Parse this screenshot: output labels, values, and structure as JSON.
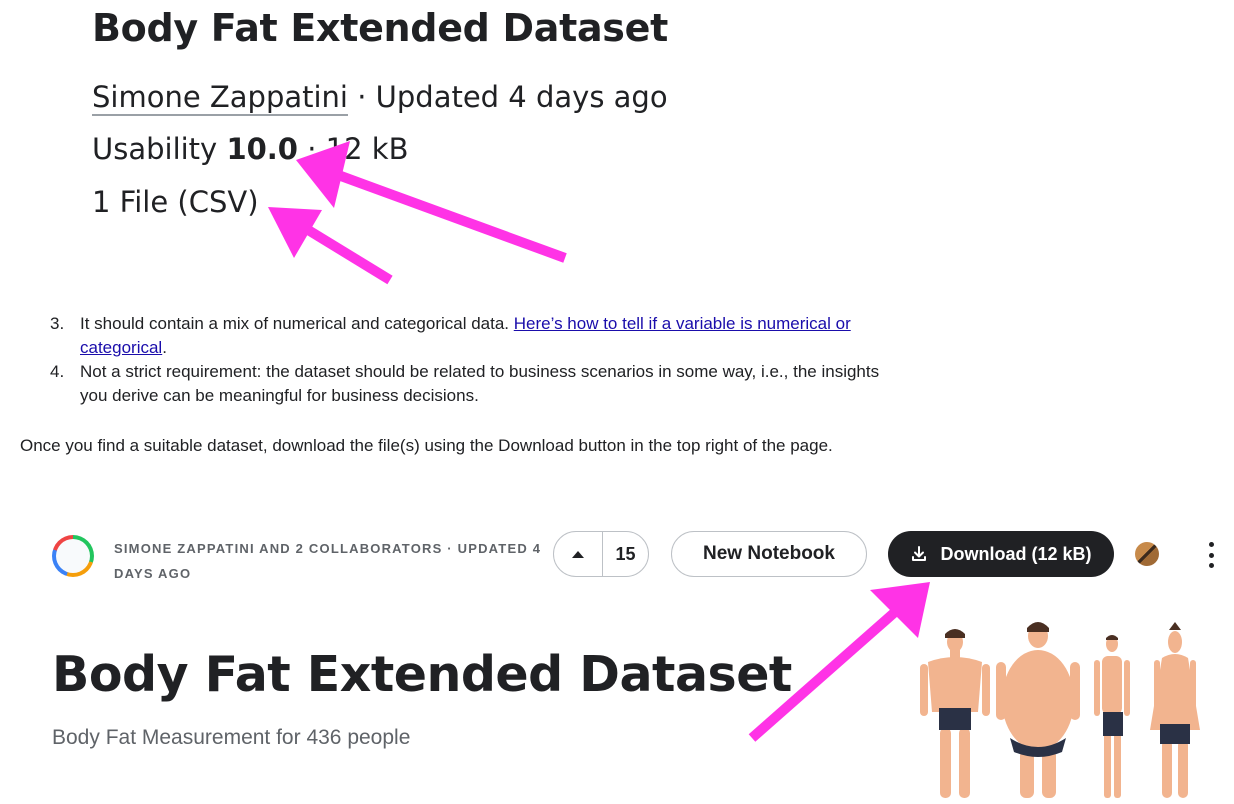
{
  "snippet": {
    "title": "Body Fat Extended Dataset",
    "author": "Simone Zappatini",
    "updated": " · Updated 4 days ago",
    "usability_label": "Usability ",
    "usability_value": "10.0",
    "size": " · 12 kB",
    "files": "1 File (CSV)"
  },
  "instructions": {
    "items": [
      {
        "num": "3.",
        "text": "It should contain a mix of numerical and categorical data. ",
        "link": "Here’s how to tell if a variable is numerical or categorical",
        "after": "."
      },
      {
        "num": "4.",
        "text": "Not a strict requirement: the dataset should be related to business scenarios in some way, i.e., the insights you derive can be meaningful for business decisions."
      }
    ],
    "paragraph": "Once you find a suitable dataset, download the file(s) using the Download button in the top right of the page."
  },
  "header": {
    "collaborators": "Simone Zappatini and 2 collaborators · Updated 4 days ago",
    "vote_count": "15",
    "new_notebook": "New Notebook",
    "download": "Download (12 kB)"
  },
  "dataset": {
    "title": "Body Fat Extended Dataset",
    "subtitle": "Body Fat Measurement for 436 people"
  },
  "colors": {
    "annotation_arrow": "#ff33e6",
    "download_button": "#202124",
    "link": "#1a0dab"
  },
  "icons": [
    "arrow-up-icon",
    "download-icon",
    "more-vert-icon"
  ]
}
